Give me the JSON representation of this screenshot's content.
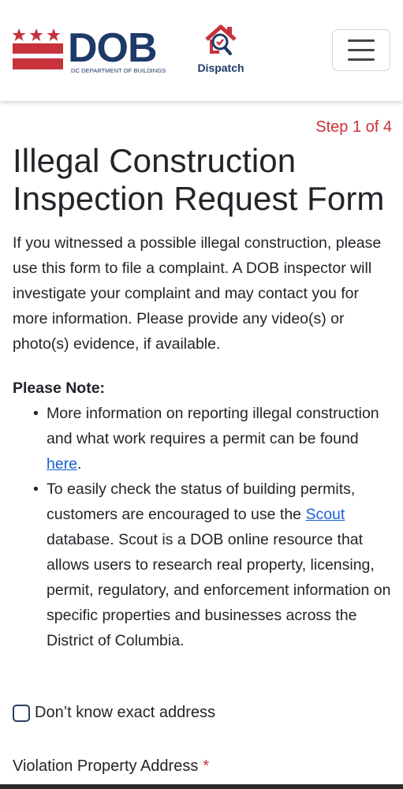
{
  "header": {
    "logo_text": "DOB",
    "logo_subtitle": "DC DEPARTMENT OF BUILDINGS",
    "dispatch_label": "Dispatch",
    "menu_icon": "hamburger-menu-icon",
    "colors": {
      "dc_red": "#c8323c",
      "navy": "#1f3a68"
    }
  },
  "form": {
    "step": "Step 1 of 4",
    "title": "Illegal Construction Inspection Request Form",
    "intro": "If you witnessed a possible illegal construction, please use this form to file a complaint. A DOB inspector will investigate your complaint and may contact you for more information. Please provide any video(s) or photo(s) evidence, if available.",
    "note_heading": "Please Note:",
    "notes": [
      {
        "before": "More information on reporting illegal construction and what work requires a permit can be found ",
        "link": "here",
        "after": "."
      },
      {
        "before": "To easily check the status of building permits, customers are encouraged to use the ",
        "link": "Scout",
        "after": " database. Scout is a DOB online resource that allows users to research real property, licensing, permit, regulatory, and enforcement information on specific properties and businesses across the District of Columbia."
      }
    ],
    "checkbox_label": "Don’t know exact address",
    "checkbox_checked": false,
    "address_label": "Violation Property Address",
    "required_mark": "*"
  }
}
